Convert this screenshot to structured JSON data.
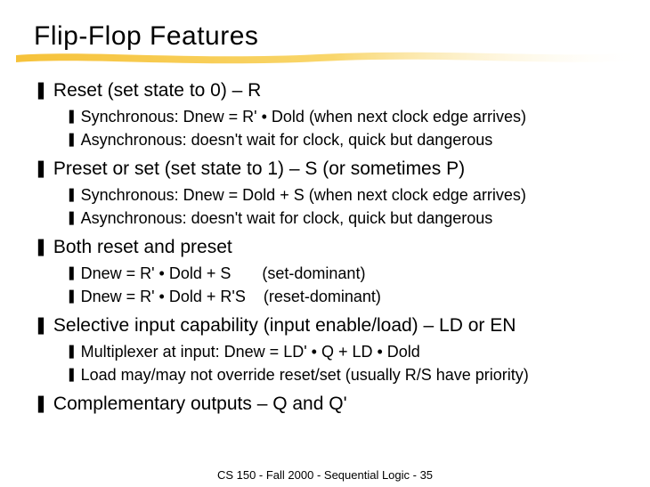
{
  "title": "Flip-Flop Features",
  "items": [
    {
      "text": "Reset (set state to 0) – R",
      "subs": [
        "Synchronous: Dnew = R' • Dold (when next clock edge arrives)",
        "Asynchronous: doesn't wait for clock, quick but dangerous"
      ]
    },
    {
      "text": "Preset or set (set state to 1) – S (or sometimes P)",
      "subs": [
        "Synchronous: Dnew = Dold + S (when next clock edge arrives)",
        "Asynchronous: doesn't wait for clock, quick but dangerous"
      ]
    },
    {
      "text": "Both reset and preset",
      "subs": [
        "Dnew = R' • Dold + S       (set-dominant)",
        "Dnew = R' • Dold + R'S    (reset-dominant)"
      ]
    },
    {
      "text": "Selective input capability (input enable/load) – LD or EN",
      "subs": [
        "Multiplexer at input: Dnew = LD' • Q + LD • Dold",
        "Load may/may not override reset/set (usually R/S have priority)"
      ]
    },
    {
      "text": "Complementary outputs – Q and Q'",
      "subs": []
    }
  ],
  "footer": "CS 150 - Fall  2000 - Sequential Logic - 35",
  "markers": {
    "l1": "❚",
    "l2": "❚"
  },
  "colors": {
    "l1_marker": "#000000",
    "l2_marker": "#000000"
  }
}
